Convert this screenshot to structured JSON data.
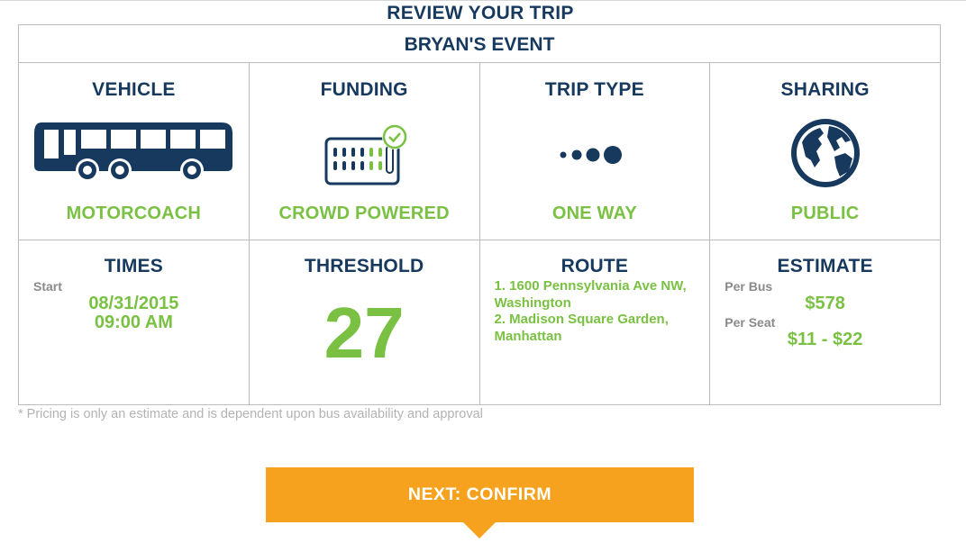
{
  "header": {
    "title": "REVIEW YOUR TRIP"
  },
  "event": {
    "name": "BRYAN'S EVENT"
  },
  "summary": {
    "vehicle": {
      "heading": "VEHICLE",
      "value": "MOTORCOACH",
      "icon": "bus-icon"
    },
    "funding": {
      "heading": "FUNDING",
      "value": "CROWD POWERED",
      "icon": "crowd-funding-icon"
    },
    "trip_type": {
      "heading": "TRIP TYPE",
      "value": "ONE WAY",
      "icon": "one-way-dots-icon"
    },
    "sharing": {
      "heading": "SHARING",
      "value": "PUBLIC",
      "icon": "globe-icon"
    }
  },
  "details": {
    "times": {
      "heading": "TIMES",
      "start_label": "Start",
      "date": "08/31/2015",
      "time": "09:00 AM"
    },
    "threshold": {
      "heading": "THRESHOLD",
      "value": "27"
    },
    "route": {
      "heading": "ROUTE",
      "stops": [
        "1. 1600 Pennsylvania Ave NW, Washington",
        "2. Madison Square Garden, Manhattan"
      ]
    },
    "estimate": {
      "heading": "ESTIMATE",
      "per_bus_label": "Per Bus",
      "per_bus_value": "$578",
      "per_seat_label": "Per Seat",
      "per_seat_value": "$11 - $22"
    }
  },
  "footnote": "* Pricing is only an estimate and is dependent upon bus availability and approval",
  "actions": {
    "next_label": "NEXT: CONFIRM"
  },
  "colors": {
    "navy": "#16395d",
    "green": "#7ac143",
    "orange": "#f6a21e",
    "border": "#bcbcbc"
  }
}
